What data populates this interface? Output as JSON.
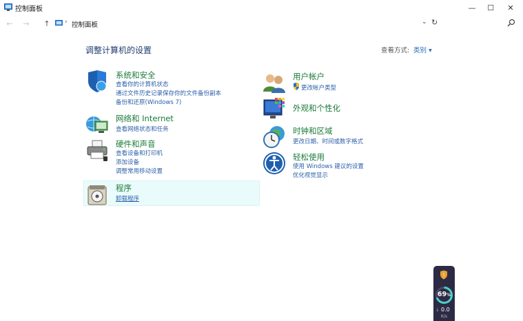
{
  "window": {
    "title": "控制面板",
    "minimize": "—",
    "maximize": "☐",
    "close": "✕"
  },
  "addressbar": {
    "path": "控制面板",
    "back_icon": "←",
    "forward_icon": "→",
    "up_icon": "↑",
    "separator": "›",
    "dropdown_icon": "⌄",
    "refresh_icon": "↻"
  },
  "main": {
    "heading": "调整计算机的设置",
    "view_by_label": "查看方式:",
    "view_by_value": "类别 ▾"
  },
  "categories": [
    {
      "title": "系统和安全",
      "icon": "shield-icon",
      "links": [
        "查看你的计算机状态",
        "通过文件历史记录保存你的文件备份副本",
        "备份和还原(Windows 7)"
      ]
    },
    {
      "title": "网络和 Internet",
      "icon": "network-icon",
      "links": [
        "查看网络状态和任务"
      ]
    },
    {
      "title": "硬件和声音",
      "icon": "printer-icon",
      "links": [
        "查看设备和打印机",
        "添加设备",
        "调整常用移动设置"
      ]
    },
    {
      "title": "程序",
      "icon": "programs-icon",
      "links": [
        "卸载程序"
      ]
    },
    {
      "title": "用户帐户",
      "icon": "users-icon",
      "links": [
        "更改帐户类型"
      ]
    },
    {
      "title": "外观和个性化",
      "icon": "appearance-icon",
      "links": []
    },
    {
      "title": "时钟和区域",
      "icon": "clock-globe-icon",
      "links": [
        "更改日期、时间或数字格式"
      ]
    },
    {
      "title": "轻松使用",
      "icon": "ease-of-access-icon",
      "links": [
        "使用 Windows 建议的设置",
        "优化视觉显示"
      ]
    }
  ],
  "widget": {
    "percent": "69",
    "percent_sign": "%",
    "speed": "0.0",
    "speed_unit": "K/s",
    "down_arrow": "↓"
  }
}
